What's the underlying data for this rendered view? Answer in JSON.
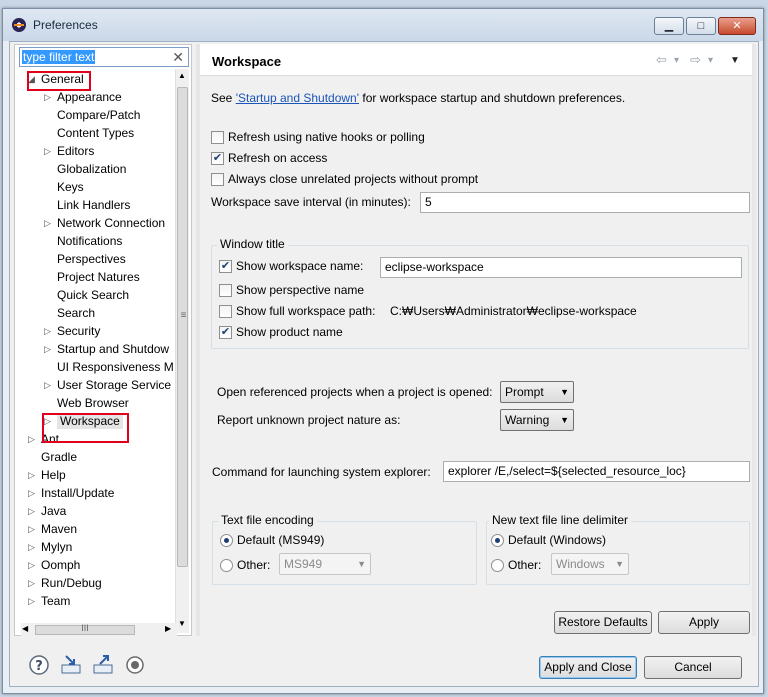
{
  "window": {
    "title": "Preferences",
    "min_label": "▁",
    "max_label": "□",
    "close_label": "✕"
  },
  "filter": {
    "value": "type filter text",
    "clear": "✕"
  },
  "tree": [
    {
      "label": "General",
      "twisty": "◢",
      "level": 0,
      "highlight": true
    },
    {
      "label": "Appearance",
      "twisty": "▷",
      "level": 1
    },
    {
      "label": "Compare/Patch",
      "twisty": "",
      "level": 1
    },
    {
      "label": "Content Types",
      "twisty": "",
      "level": 1
    },
    {
      "label": "Editors",
      "twisty": "▷",
      "level": 1
    },
    {
      "label": "Globalization",
      "twisty": "",
      "level": 1
    },
    {
      "label": "Keys",
      "twisty": "",
      "level": 1
    },
    {
      "label": "Link Handlers",
      "twisty": "",
      "level": 1
    },
    {
      "label": "Network Connection",
      "twisty": "▷",
      "level": 1
    },
    {
      "label": "Notifications",
      "twisty": "",
      "level": 1
    },
    {
      "label": "Perspectives",
      "twisty": "",
      "level": 1
    },
    {
      "label": "Project Natures",
      "twisty": "",
      "level": 1
    },
    {
      "label": "Quick Search",
      "twisty": "",
      "level": 1
    },
    {
      "label": "Search",
      "twisty": "",
      "level": 1
    },
    {
      "label": "Security",
      "twisty": "▷",
      "level": 1
    },
    {
      "label": "Startup and Shutdow",
      "twisty": "▷",
      "level": 1
    },
    {
      "label": "UI Responsiveness M",
      "twisty": "",
      "level": 1
    },
    {
      "label": "User Storage Service",
      "twisty": "▷",
      "level": 1
    },
    {
      "label": "Web Browser",
      "twisty": "",
      "level": 1
    },
    {
      "label": "Workspace",
      "twisty": "▷",
      "level": 1,
      "highlight": true,
      "selected": true
    },
    {
      "label": "Ant",
      "twisty": "▷",
      "level": 0
    },
    {
      "label": "Gradle",
      "twisty": "",
      "level": 0
    },
    {
      "label": "Help",
      "twisty": "▷",
      "level": 0
    },
    {
      "label": "Install/Update",
      "twisty": "▷",
      "level": 0
    },
    {
      "label": "Java",
      "twisty": "▷",
      "level": 0
    },
    {
      "label": "Maven",
      "twisty": "▷",
      "level": 0
    },
    {
      "label": "Mylyn",
      "twisty": "▷",
      "level": 0
    },
    {
      "label": "Oomph",
      "twisty": "▷",
      "level": 0
    },
    {
      "label": "Run/Debug",
      "twisty": "▷",
      "level": 0
    },
    {
      "label": "Team",
      "twisty": "▷",
      "level": 0
    }
  ],
  "header": {
    "title": "Workspace",
    "back": "⇦",
    "forward": "⇨",
    "dropdown": "▾",
    "menu": "▼"
  },
  "intro": {
    "prefix": "See ",
    "link": "'Startup and Shutdown'",
    "suffix": " for workspace startup and shutdown preferences."
  },
  "options": {
    "refresh_native": {
      "label": "Refresh using native hooks or polling",
      "checked": false
    },
    "refresh_access": {
      "label": "Refresh on access",
      "checked": true
    },
    "always_close": {
      "label": "Always close unrelated projects without prompt",
      "checked": false
    },
    "save_interval_label": "Workspace save interval (in minutes):",
    "save_interval_value": "5"
  },
  "window_title_group": {
    "title": "Window title",
    "show_name": {
      "label": "Show workspace name:",
      "checked": true,
      "value": "eclipse-workspace"
    },
    "show_perspective": {
      "label": "Show perspective name",
      "checked": false
    },
    "show_full_path": {
      "label": "Show full workspace path:",
      "checked": false,
      "value": "C:₩Users₩Administrator₩eclipse-workspace"
    },
    "show_product": {
      "label": "Show product name",
      "checked": true
    }
  },
  "open_referenced": {
    "label": "Open referenced projects when a project is opened:",
    "value": "Prompt"
  },
  "report_nature": {
    "label": "Report unknown project nature as:",
    "value": "Warning"
  },
  "explorer": {
    "label": "Command for launching system explorer:",
    "value": "explorer /E,/select=${selected_resource_loc}"
  },
  "encoding": {
    "title": "Text file encoding",
    "default_label": "Default (MS949)",
    "other_label": "Other:",
    "other_value": "MS949"
  },
  "delimiter": {
    "title": "New text file line delimiter",
    "default_label": "Default (Windows)",
    "other_label": "Other:",
    "other_value": "Windows"
  },
  "buttons": {
    "restore": "Restore Defaults",
    "apply": "Apply",
    "apply_close": "Apply and Close",
    "cancel": "Cancel"
  },
  "tree_scroll": {
    "h_thumb_label": "III",
    "v_thumb_label": "≡"
  },
  "icons": {
    "help": "help-icon",
    "import": "import-icon",
    "export": "export-icon",
    "record": "record-icon"
  }
}
